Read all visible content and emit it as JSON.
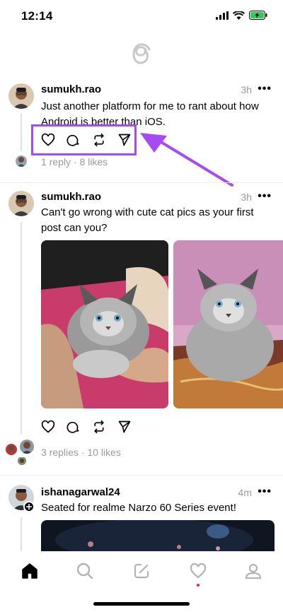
{
  "status_bar": {
    "time": "12:14"
  },
  "posts": [
    {
      "username": "sumukh.rao",
      "time": "3h",
      "text": "Just another platform for me to rant about how Android is better than iOS.",
      "meta": "1 reply · 8 likes"
    },
    {
      "username": "sumukh.rao",
      "time": "3h",
      "text": "Can't go wrong with cute cat pics as your first post can you?",
      "meta": "3 replies · 10 likes"
    },
    {
      "username": "ishanagarwal24",
      "time": "4m",
      "text": "Seated for realme Narzo 60 Series event!"
    }
  ],
  "more_label": "•••",
  "annotation": {
    "highlight_color": "#a64bf4"
  },
  "tab_bar": {
    "items": [
      "home-icon",
      "search-icon",
      "compose-icon",
      "activity-icon",
      "profile-icon"
    ]
  }
}
